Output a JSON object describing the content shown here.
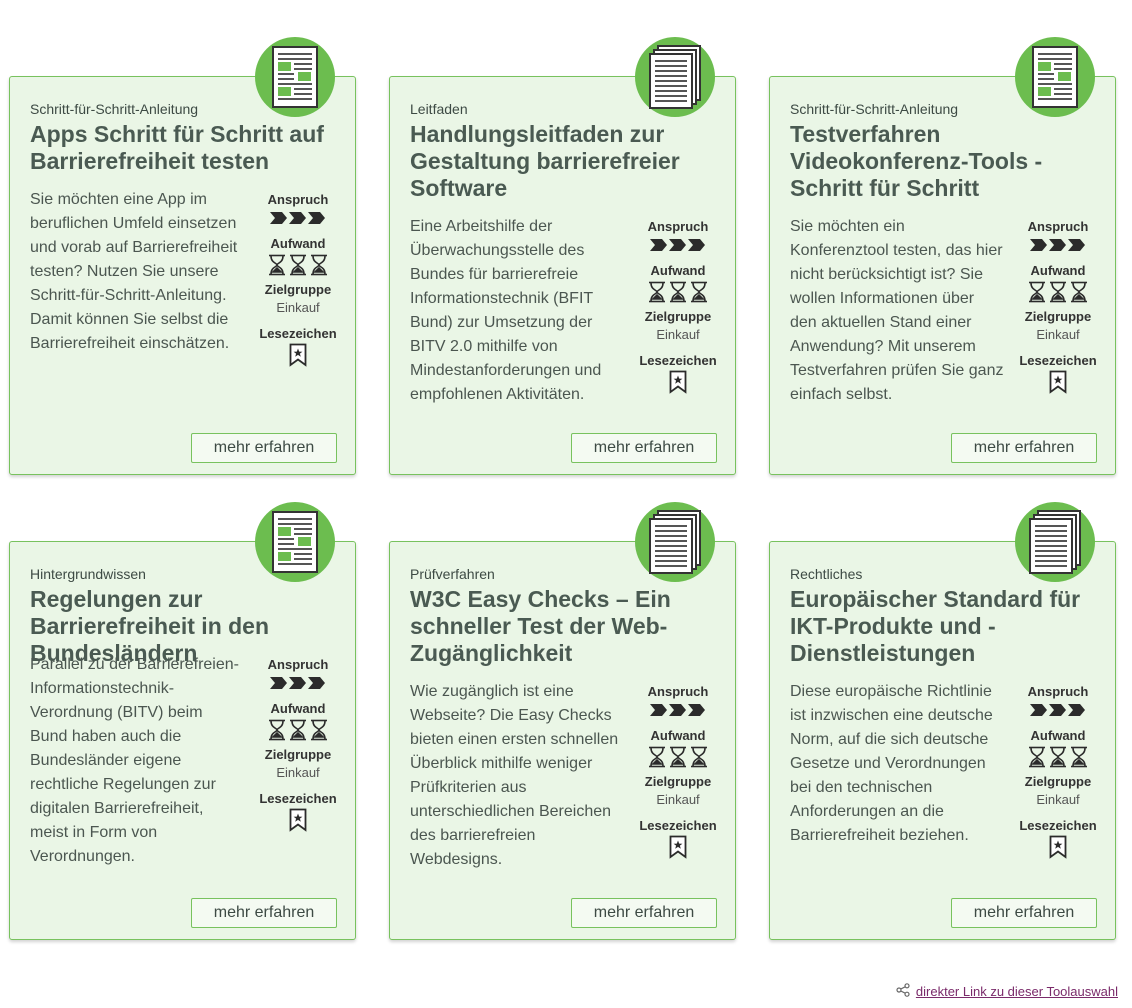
{
  "cards": [
    {
      "category": "Schritt-für-Schritt-Anleitung",
      "title": "Apps Schritt für Schritt auf Barrierefreiheit testen",
      "description": "Sie möchten eine App im beruflichen Umfeld einsetzen und vorab auf Barrierefreiheit testen? Nutzen Sie unsere Schritt-für-Schritt-Anleitung. Damit können Sie selbst die Barrierefreiheit einschätzen.",
      "badge_icon": "document-icon",
      "anspruch_label": "Anspruch",
      "anspruch_level": 3,
      "aufwand_label": "Aufwand",
      "aufwand_level": 3,
      "zielgruppe_label": "Zielgruppe",
      "zielgruppe_value": "Einkauf",
      "lesezeichen_label": "Lesezeichen",
      "button_label": "mehr erfahren"
    },
    {
      "category": "Leitfaden",
      "title": "Handlungsleitfaden zur Gestaltung barrierefreier Software",
      "description": "Eine Arbeitshilfe der Überwachungsstelle des Bundes für barrierefreie Informationstechnik (BFIT Bund) zur Umsetzung der BITV 2.0 mithilfe von Mindestanforderungen und empfohlenen Aktivitäten.",
      "badge_icon": "document-stack-icon",
      "anspruch_label": "Anspruch",
      "anspruch_level": 3,
      "aufwand_label": "Aufwand",
      "aufwand_level": 3,
      "zielgruppe_label": "Zielgruppe",
      "zielgruppe_value": "Einkauf",
      "lesezeichen_label": "Lesezeichen",
      "button_label": "mehr erfahren"
    },
    {
      "category": "Schritt-für-Schritt-Anleitung",
      "title": "Testverfahren Videokonferenz-Tools - Schritt für Schritt",
      "description": "Sie möchten ein Konferenztool testen, das hier nicht berücksichtigt ist? Sie wollen Informationen über den aktuellen Stand einer Anwendung? Mit unserem Testverfahren prüfen Sie ganz einfach selbst.",
      "badge_icon": "document-icon",
      "anspruch_label": "Anspruch",
      "anspruch_level": 3,
      "aufwand_label": "Aufwand",
      "aufwand_level": 3,
      "zielgruppe_label": "Zielgruppe",
      "zielgruppe_value": "Einkauf",
      "lesezeichen_label": "Lesezeichen",
      "button_label": "mehr erfahren"
    },
    {
      "category": "Hintergrundwissen",
      "title": "Regelungen zur Barrierefreiheit in den Bundesländern",
      "description": "Parallel zu der Barrierefreien-Informationstechnik-Verordnung (BITV) beim Bund haben auch die Bundesländer eigene rechtliche Regelungen zur digitalen Barrierefreiheit, meist in Form von Verordnungen.",
      "badge_icon": "document-icon",
      "anspruch_label": "Anspruch",
      "anspruch_level": 3,
      "aufwand_label": "Aufwand",
      "aufwand_level": 3,
      "zielgruppe_label": "Zielgruppe",
      "zielgruppe_value": "Einkauf",
      "lesezeichen_label": "Lesezeichen",
      "button_label": "mehr erfahren"
    },
    {
      "category": "Prüfverfahren",
      "title": "W3C Easy Checks – Ein schneller Test der Web-Zugänglichkeit",
      "description": "Wie zugänglich ist eine Webseite? Die Easy Checks bieten einen ersten schnellen Überblick mithilfe weniger Prüfkriterien aus unterschiedlichen Bereichen des barrierefreien Webdesigns.",
      "badge_icon": "document-stack-icon",
      "anspruch_label": "Anspruch",
      "anspruch_level": 3,
      "aufwand_label": "Aufwand",
      "aufwand_level": 3,
      "zielgruppe_label": "Zielgruppe",
      "zielgruppe_value": "Einkauf",
      "lesezeichen_label": "Lesezeichen",
      "button_label": "mehr erfahren"
    },
    {
      "category": "Rechtliches",
      "title": "Europäischer Standard für IKT-Produkte und -Dienstleistungen",
      "description": "Diese europäische Richtlinie ist inzwischen eine deutsche Norm, auf die sich deutsche Gesetze und Verordnungen bei den technischen Anforderungen an die Barrierefreiheit beziehen.",
      "badge_icon": "document-stack-icon",
      "anspruch_label": "Anspruch",
      "anspruch_level": 3,
      "aufwand_label": "Aufwand",
      "aufwand_level": 3,
      "zielgruppe_label": "Zielgruppe",
      "zielgruppe_value": "Einkauf",
      "lesezeichen_label": "Lesezeichen",
      "button_label": "mehr erfahren"
    }
  ],
  "footer": {
    "link_label": "direkter Link zu dieser Toolauswahl",
    "link_icon": "share-icon"
  },
  "colors": {
    "card_background": "#eaf6e6",
    "card_border": "#78c25e",
    "badge_green": "#6cbd4f",
    "link_color": "#7a2a6a"
  }
}
